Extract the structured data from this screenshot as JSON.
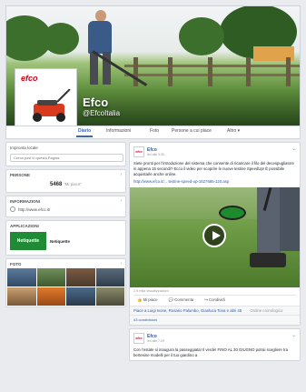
{
  "page": {
    "name": "Efco",
    "handle": "@EfcoItalia",
    "profile_logo_text": "efco"
  },
  "tabs": [
    "Diario",
    "Informazioni",
    "Foto",
    "Persone a cui piace",
    "Altro"
  ],
  "sidebar": {
    "search": {
      "title": "Impronta locale",
      "placeholder": "Cerca post in questa Pagina"
    },
    "likes": {
      "title": "Persone",
      "count": "5468",
      "suffix": "\"Mi piace\""
    },
    "info": {
      "title": "Informazioni",
      "url": "http://www.efco.it/"
    },
    "apps": {
      "title": "Applicazioni",
      "tile": "Netiquette",
      "label": "Netiquette"
    },
    "photos": {
      "title": "Foto"
    }
  },
  "posts": [
    {
      "name": "Efco",
      "time": "ieri alle 9:30",
      "text": "Siete pronti per l'introduzione del sistema che consente di ricaricare il filo del decespugliatore in appena 15 secondi? Ecco il video per scoprire le nuove testine SpeedUp! È possibile acquistarle anche online.",
      "link": "http://www.efco.it/... testine-speed-up-1627685-120.asp",
      "views": "2.9 mila visualizzazioni",
      "actions": [
        "Mi piace",
        "Commenta",
        "Condividi"
      ],
      "likers": "Piace a Luigi Ivone, Rosario Palumbo, Gianluca Tona e altri 45",
      "ranking": "Ordine cronologico",
      "shares": "43 condivisioni"
    },
    {
      "name": "Efco",
      "time": "ieri alle 7:29",
      "text": "Con l'estate si inaugura la passeggiata! Il verde! FINO AL 30 GIUGNO potrai scegliere tra bertesine modelli per il tuo giardino a"
    }
  ],
  "colors": {
    "accent": "#4267b2",
    "link": "#365899",
    "brand_red": "#d0021b",
    "app_green": "#1f8b35"
  }
}
